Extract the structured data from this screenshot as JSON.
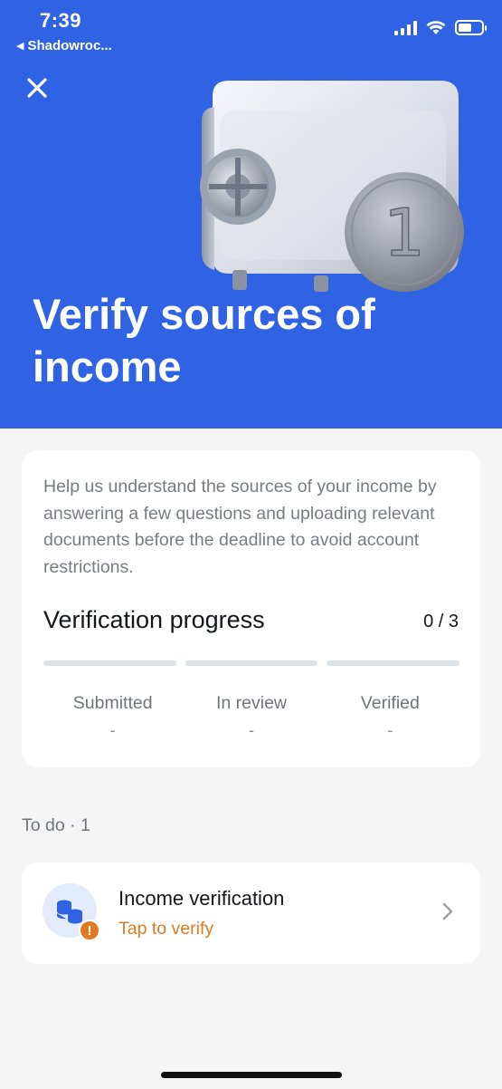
{
  "status_bar": {
    "time": "7:39",
    "back_app": "Shadowroc...",
    "back_arrow": "◀"
  },
  "hero": {
    "close_icon": "close-icon",
    "title": "Verify sources of income",
    "background_color": "#2f63e4",
    "illustration": "safe-with-coin",
    "coin_digit": "1"
  },
  "info_card": {
    "description": "Help us understand the sources of your income by answering a few questions and uploading relevant documents before the deadline to avoid account restrictions.",
    "progress_title": "Verification progress",
    "progress_count": "0 / 3",
    "progress": 0,
    "steps": [
      {
        "label": "Submitted",
        "value": "-"
      },
      {
        "label": "In review",
        "value": "-"
      },
      {
        "label": "Verified",
        "value": "-"
      }
    ]
  },
  "todo": {
    "header": "To do · 1",
    "task": {
      "title": "Income verification",
      "subtitle": "Tap to verify",
      "icon": "coins-icon",
      "badge_icon": "warning-icon",
      "badge_symbol": "!",
      "accent_color": "#e07a1f"
    }
  }
}
